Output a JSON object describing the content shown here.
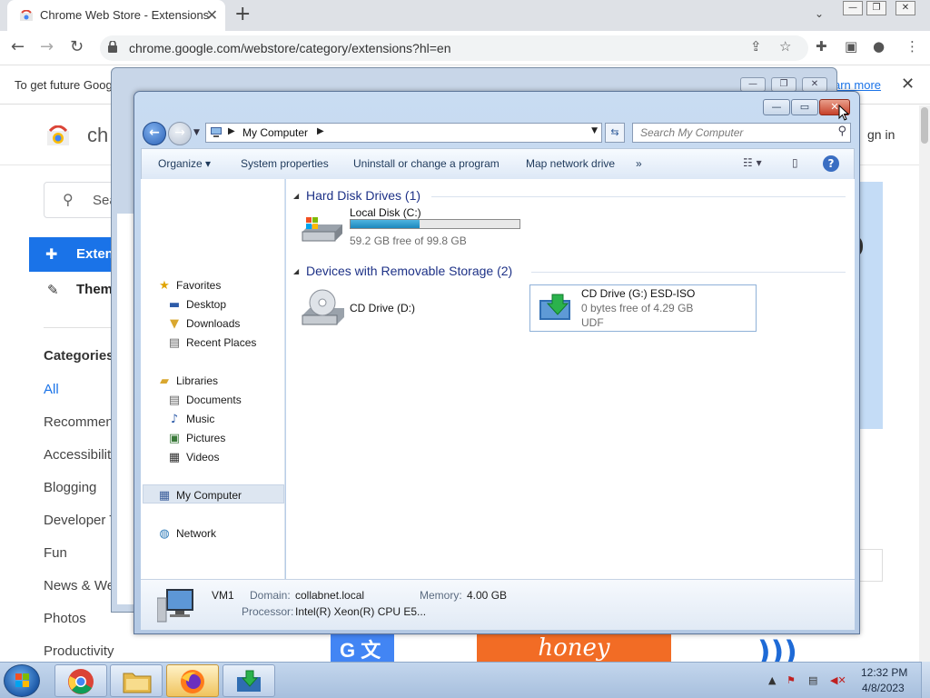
{
  "chrome": {
    "tab_title": "Chrome Web Store - Extensions",
    "tab_close": "✕",
    "new_tab": "+",
    "url": "chrome.google.com/webstore/category/extensions?hl=en",
    "info_message": "To get future Goog",
    "info_link": "arn more",
    "info_close": "✕"
  },
  "store": {
    "brand": "ch",
    "sign_in": "gn in",
    "search_placeholder": "Sea",
    "nav_extensions": "Exten",
    "nav_themes": "Them",
    "categories_title": "Categories",
    "categories": [
      "All",
      "Recommen",
      "Accessibilit",
      "Blogging",
      "Developer T",
      "Fun",
      "News & We",
      "Photos",
      "Productivity"
    ],
    "tile_google_text": "G 文",
    "tile_honey_text": "honey"
  },
  "explorer": {
    "address": "My Computer",
    "search_placeholder": "Search My Computer",
    "commands": {
      "organize": "Organize",
      "system_properties": "System properties",
      "uninstall": "Uninstall or change a program",
      "map_drive": "Map network drive",
      "more": "»"
    },
    "nav": {
      "favorites": "Favorites",
      "desktop": "Desktop",
      "downloads": "Downloads",
      "recent": "Recent Places",
      "libraries": "Libraries",
      "documents": "Documents",
      "music": "Music",
      "pictures": "Pictures",
      "videos": "Videos",
      "my_computer": "My Computer",
      "network": "Network"
    },
    "groups": {
      "hard_disks": "Hard Disk Drives (1)",
      "removable": "Devices with Removable Storage (2)"
    },
    "drives": {
      "c_name": "Local Disk (C:)",
      "c_free": "59.2 GB free of 99.8 GB",
      "c_used_fraction": 0.407,
      "d_name": "CD Drive (D:)",
      "g_name": "CD Drive (G:) ESD-ISO",
      "g_free": "0 bytes free of 4.29 GB",
      "g_fs": "UDF"
    },
    "details": {
      "computer_name": "VM1",
      "domain_label": "Domain:",
      "domain": "collabnet.local",
      "memory_label": "Memory:",
      "memory": "4.00 GB",
      "processor_label": "Processor:",
      "processor": "Intel(R) Xeon(R) CPU E5..."
    }
  },
  "taskbar": {
    "time": "12:32 PM",
    "date": "4/8/2023"
  },
  "colors": {
    "chrome_accent": "#1a73e8",
    "explorer_link": "#1e3287",
    "progress": "#1c88bd"
  }
}
